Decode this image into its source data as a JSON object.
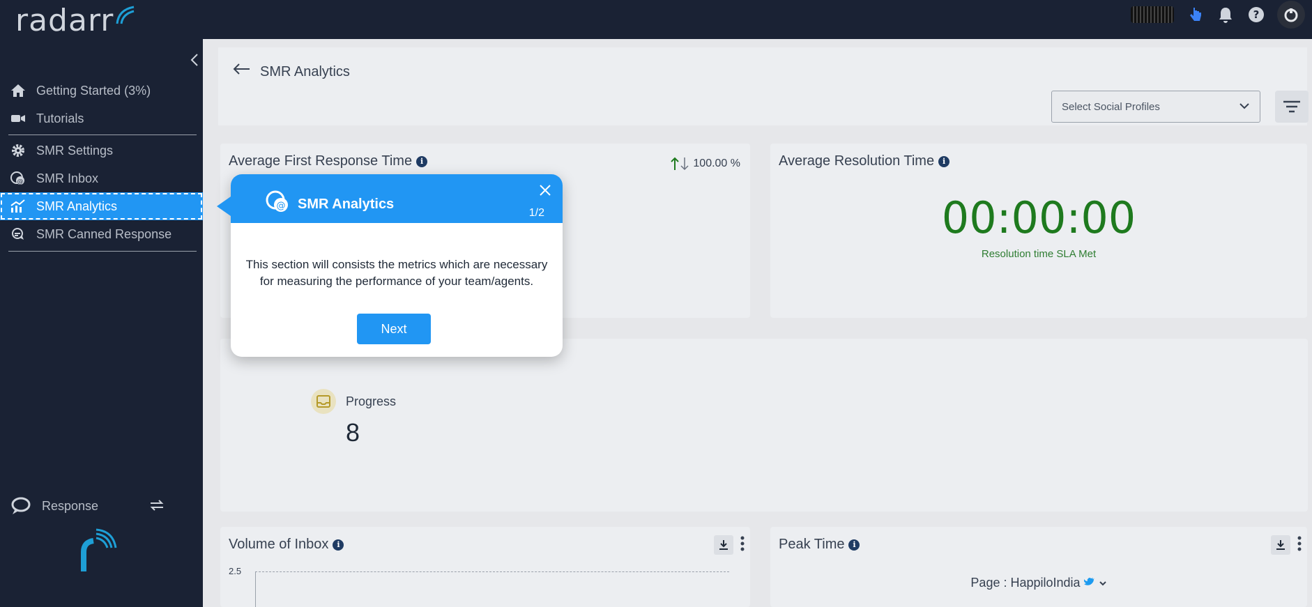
{
  "app": {
    "logo_text": "radarr"
  },
  "colors": {
    "accent": "#2196f3",
    "sidebar_bg": "#1a2234",
    "success": "#1e7a1e"
  },
  "sidebar": {
    "items": [
      {
        "label": "Getting Started (3%)",
        "icon": "home-icon"
      },
      {
        "label": "Tutorials",
        "icon": "video-icon"
      },
      {
        "label": "SMR Settings",
        "icon": "gear-icon"
      },
      {
        "label": "SMR Inbox",
        "icon": "inbox-chat-icon"
      },
      {
        "label": "SMR Analytics",
        "icon": "analytics-icon",
        "active": true
      },
      {
        "label": "SMR Canned Response",
        "icon": "canned-response-icon"
      }
    ],
    "response_label": "Response"
  },
  "header": {
    "back_icon": "arrow-left-icon",
    "title": "SMR Analytics",
    "select_placeholder": "Select Social Profiles"
  },
  "cards": {
    "first_response": {
      "title": "Average First Response Time",
      "trend": "100.00 %"
    },
    "resolution": {
      "title": "Average Resolution Time",
      "value": "00:00:00",
      "sla": "Resolution time SLA Met"
    },
    "progress": {
      "label": "Progress",
      "value": "8"
    },
    "volume": {
      "title": "Volume of Inbox",
      "y_tick": "2.5"
    },
    "peak": {
      "title": "Peak Time",
      "page": "Page : HappiloIndia"
    }
  },
  "popover": {
    "title": "SMR Analytics",
    "step": "1/2",
    "body": "This section will consists the metrics which are necessary for measuring the performance of your team/agents.",
    "next_label": "Next"
  }
}
